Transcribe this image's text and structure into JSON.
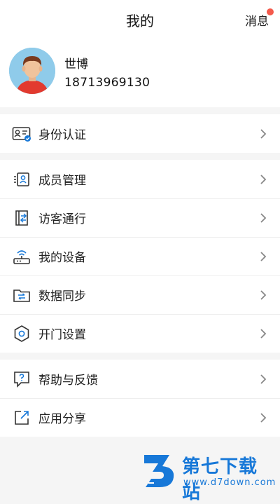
{
  "header": {
    "title": "我的",
    "message_label": "消息"
  },
  "profile": {
    "name": "世博",
    "phone": "18713969130"
  },
  "groups": [
    [
      {
        "label": "身份认证",
        "icon": "id-card-icon"
      }
    ],
    [
      {
        "label": "成员管理",
        "icon": "member-icon"
      },
      {
        "label": "访客通行",
        "icon": "visitor-pass-icon"
      },
      {
        "label": "我的设备",
        "icon": "router-icon"
      },
      {
        "label": "数据同步",
        "icon": "folder-sync-icon"
      },
      {
        "label": "开门设置",
        "icon": "hexagon-settings-icon"
      }
    ],
    [
      {
        "label": "帮助与反馈",
        "icon": "help-chat-icon"
      },
      {
        "label": "应用分享",
        "icon": "share-icon"
      }
    ]
  ],
  "watermark": {
    "brand": "第七下载站",
    "url": "www.d7down.com"
  },
  "colors": {
    "accent_blue": "#1778d8",
    "badge_red": "#f45a4c",
    "icon_stroke": "#333333"
  }
}
